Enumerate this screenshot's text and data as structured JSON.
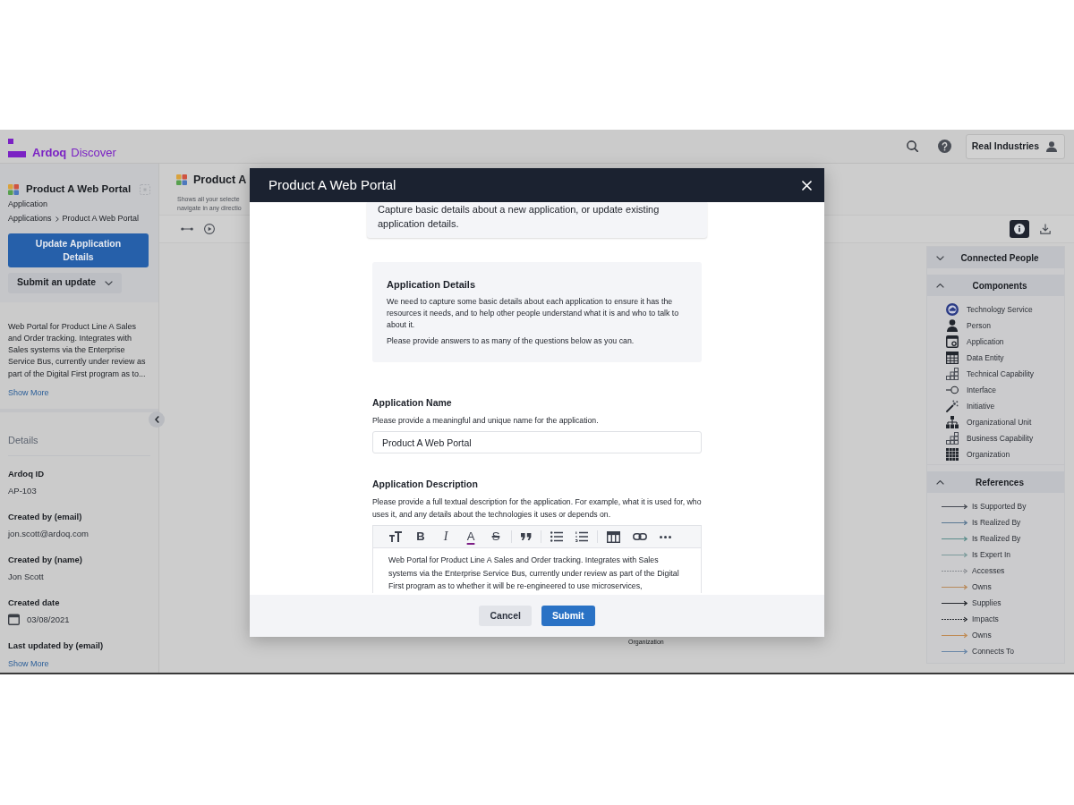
{
  "header": {
    "brand": "Ardoq",
    "product": "Discover",
    "account": "Real Industries"
  },
  "sidebar": {
    "title": "Product A Web Portal",
    "type": "Application",
    "breadcrumb": [
      "Applications",
      "Product A Web Portal"
    ],
    "primary_button": "Update Application Details",
    "update_button": "Submit an update",
    "description": "Web Portal for Product Line A Sales and Order tracking. Integrates with Sales systems via the Enterprise Service Bus, currently under review as part of the Digital First program as to...",
    "description_link": "Show More",
    "details_title": "Details",
    "details": [
      {
        "kind": "text",
        "label": "Ardoq ID",
        "value": "AP-103"
      },
      {
        "kind": "text",
        "label": "Created by (email)",
        "value": "jon.scott@ardoq.com"
      },
      {
        "kind": "text",
        "label": "Created by (name)",
        "value": "Jon Scott"
      },
      {
        "kind": "date",
        "label": "Created date",
        "value": "03/08/2021"
      },
      {
        "kind": "text",
        "label": "Last updated by (email)"
      }
    ],
    "details_link": "Show More"
  },
  "view": {
    "title": "Product A",
    "subtitle": [
      "Shows all your selecte",
      "navigate in any directio"
    ],
    "canvas_label": "Organization"
  },
  "right_panel": {
    "info_selected": true,
    "sections": [
      {
        "title": "Connected People",
        "expanded": false
      },
      {
        "title": "Components",
        "expanded": true,
        "items": [
          {
            "kind": "service",
            "label": "Technology Service"
          },
          {
            "kind": "person",
            "label": "Person"
          },
          {
            "kind": "application",
            "label": "Application"
          },
          {
            "kind": "entity",
            "label": "Data Entity"
          },
          {
            "kind": "capability",
            "label": "Technical Capability"
          },
          {
            "kind": "interface",
            "label": "Interface"
          },
          {
            "kind": "initiative",
            "label": "Initiative"
          },
          {
            "kind": "unit",
            "label": "Organizational Unit"
          },
          {
            "kind": "capability",
            "label": "Business Capability"
          },
          {
            "kind": "organization",
            "label": "Organization"
          }
        ]
      },
      {
        "title": "References",
        "expanded": true,
        "items": [
          {
            "kind": "solid",
            "label": "Is Supported By",
            "color": "#454952"
          },
          {
            "kind": "solid",
            "label": "Is Realized By",
            "color": "#5a7893"
          },
          {
            "kind": "solid",
            "label": "Is Realized By",
            "color": "#5b8d8b"
          },
          {
            "kind": "solid",
            "label": "Is Expert In",
            "color": "#7d9c9c"
          },
          {
            "kind": "dotted",
            "label": "Accesses",
            "color": "#8b8e94"
          },
          {
            "kind": "solid",
            "label": "Owns",
            "color": "#b88a5b"
          },
          {
            "kind": "solid",
            "label": "Supplies",
            "color": "#25282e"
          },
          {
            "kind": "dotted",
            "label": "Impacts",
            "color": "#25282e"
          },
          {
            "kind": "solid",
            "label": "Owns",
            "color": "#bf8b55"
          },
          {
            "kind": "solid",
            "label": "Connects To",
            "color": "#6a87a8"
          }
        ]
      }
    ]
  },
  "modal": {
    "title": "Product A Web Portal",
    "intro": "Capture basic details about a new application, or update existing application details.",
    "section": {
      "title": "Application Details",
      "paragraphs": [
        "We need to capture some basic details about each application to ensure it has the resources it needs, and to help other people understand what it is and who to talk to about it.",
        "Please provide answers to as many of the questions below as you can."
      ]
    },
    "fields": [
      {
        "kind": "input",
        "label": "Application Name",
        "help": "Please provide a meaningful and unique name for the application.",
        "value": "Product A Web Portal"
      },
      {
        "kind": "richtext",
        "label": "Application Description",
        "help": "Please provide a full textual description for the application. For example, what it is used for, who uses it, and any details about the technologies it uses or depends on.",
        "toolbar": [
          {
            "kind": "bold",
            "label": "B"
          },
          {
            "kind": "italic",
            "label": "I"
          },
          {
            "kind": "color",
            "label": "A"
          },
          {
            "kind": "strike",
            "label": "S"
          }
        ],
        "value": "Web Portal for Product Line A Sales and Order tracking. Integrates with Sales systems via the Enterprise Service Bus, currently under review as part of the Digital First program as to whether it will be re-engineered to use microservices,"
      }
    ],
    "buttons": [
      {
        "kind": "secondary",
        "label": "Cancel"
      },
      {
        "kind": "primary",
        "label": "Submit"
      }
    ]
  }
}
